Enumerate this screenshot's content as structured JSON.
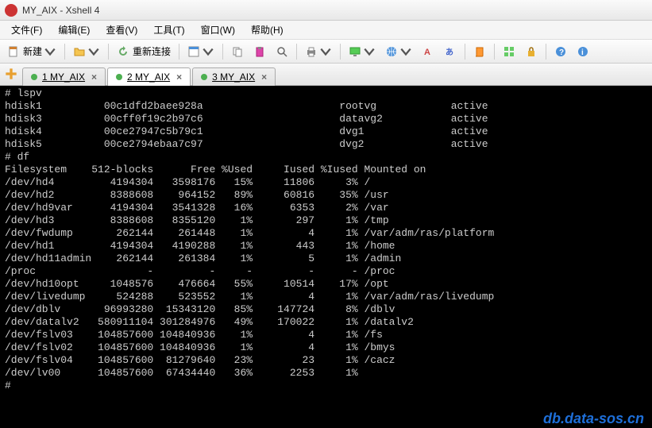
{
  "window": {
    "title": "MY_AIX - Xshell 4"
  },
  "menu": {
    "file": "文件(F)",
    "edit": "编辑(E)",
    "view": "查看(V)",
    "tool": "工具(T)",
    "window": "窗口(W)",
    "help": "帮助(H)"
  },
  "toolbar": {
    "new": "新建",
    "reconnect": "重新连接"
  },
  "tabs": [
    {
      "label": "1 MY_AIX",
      "active": false
    },
    {
      "label": "2 MY_AIX",
      "active": true
    },
    {
      "label": "3 MY_AIX",
      "active": false
    }
  ],
  "terminal": {
    "prompt": "#",
    "cmd_lspv": "lspv",
    "lspv_rows": [
      {
        "disk": "hdisk1",
        "pvid": "00c1dfd2baee928a",
        "vg": "rootvg",
        "state": "active"
      },
      {
        "disk": "hdisk3",
        "pvid": "00cff0f19c2b97c6",
        "vg": "datavg2",
        "state": "active"
      },
      {
        "disk": "hdisk4",
        "pvid": "00ce27947c5b79c1",
        "vg": "dvg1",
        "state": "active"
      },
      {
        "disk": "hdisk5",
        "pvid": "00ce2794ebaa7c97",
        "vg": "dvg2",
        "state": "active"
      }
    ],
    "cmd_df": "df",
    "df_header": {
      "fs": "Filesystem",
      "blocks": "512-blocks",
      "free": "Free",
      "used": "%Used",
      "iused": "Iused",
      "piused": "%Iused",
      "mount": "Mounted on"
    },
    "df_rows": [
      {
        "fs": "/dev/hd4",
        "blocks": "4194304",
        "free": "3598176",
        "used": "15%",
        "iused": "11806",
        "piused": "3%",
        "mount": "/"
      },
      {
        "fs": "/dev/hd2",
        "blocks": "8388608",
        "free": "964152",
        "used": "89%",
        "iused": "60816",
        "piused": "35%",
        "mount": "/usr"
      },
      {
        "fs": "/dev/hd9var",
        "blocks": "4194304",
        "free": "3541328",
        "used": "16%",
        "iused": "6353",
        "piused": "2%",
        "mount": "/var"
      },
      {
        "fs": "/dev/hd3",
        "blocks": "8388608",
        "free": "8355120",
        "used": "1%",
        "iused": "297",
        "piused": "1%",
        "mount": "/tmp"
      },
      {
        "fs": "/dev/fwdump",
        "blocks": "262144",
        "free": "261448",
        "used": "1%",
        "iused": "4",
        "piused": "1%",
        "mount": "/var/adm/ras/platform"
      },
      {
        "fs": "/dev/hd1",
        "blocks": "4194304",
        "free": "4190288",
        "used": "1%",
        "iused": "443",
        "piused": "1%",
        "mount": "/home"
      },
      {
        "fs": "/dev/hd11admin",
        "blocks": "262144",
        "free": "261384",
        "used": "1%",
        "iused": "5",
        "piused": "1%",
        "mount": "/admin"
      },
      {
        "fs": "/proc",
        "blocks": "-",
        "free": "-",
        "used": "-",
        "iused": "-",
        "piused": "-",
        "mount": "/proc"
      },
      {
        "fs": "/dev/hd10opt",
        "blocks": "1048576",
        "free": "476664",
        "used": "55%",
        "iused": "10514",
        "piused": "17%",
        "mount": "/opt"
      },
      {
        "fs": "/dev/livedump",
        "blocks": "524288",
        "free": "523552",
        "used": "1%",
        "iused": "4",
        "piused": "1%",
        "mount": "/var/adm/ras/livedump"
      },
      {
        "fs": "/dev/dblv",
        "blocks": "96993280",
        "free": "15343120",
        "used": "85%",
        "iused": "147724",
        "piused": "8%",
        "mount": "/dblv"
      },
      {
        "fs": "/dev/datalv2",
        "blocks": "580911104",
        "free": "301284976",
        "used": "49%",
        "iused": "170022",
        "piused": "1%",
        "mount": "/datalv2"
      },
      {
        "fs": "/dev/fslv03",
        "blocks": "104857600",
        "free": "104840936",
        "used": "1%",
        "iused": "4",
        "piused": "1%",
        "mount": "/fs"
      },
      {
        "fs": "/dev/fslv02",
        "blocks": "104857600",
        "free": "104840936",
        "used": "1%",
        "iused": "4",
        "piused": "1%",
        "mount": "/bmys"
      },
      {
        "fs": "/dev/fslv04",
        "blocks": "104857600",
        "free": "81279640",
        "used": "23%",
        "iused": "23",
        "piused": "1%",
        "mount": "/cacz"
      },
      {
        "fs": "/dev/lv00",
        "blocks": "104857600",
        "free": "67434440",
        "used": "36%",
        "iused": "2253",
        "piused": "1%",
        "mount": ""
      }
    ]
  },
  "watermark": "db.data-sos.cn"
}
